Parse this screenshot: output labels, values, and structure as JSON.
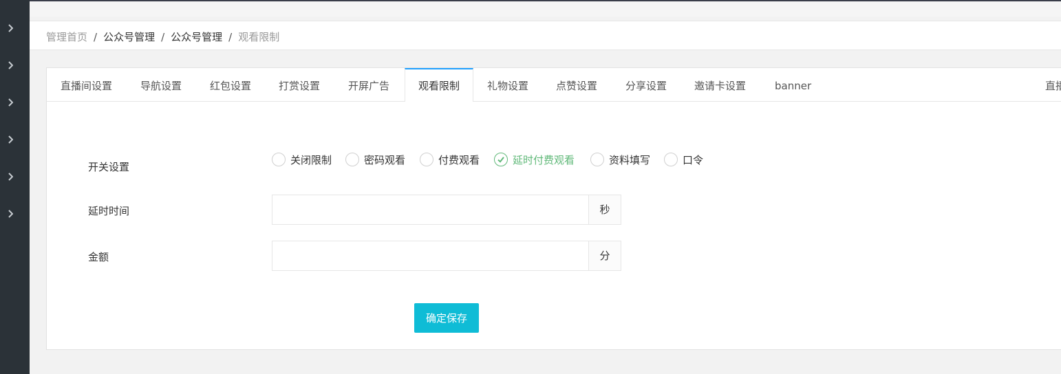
{
  "sidebar": {
    "arrow_count": 6
  },
  "breadcrumb": {
    "items": [
      "管理首页",
      "公众号管理",
      "公众号管理",
      "观看限制"
    ],
    "separator": "/"
  },
  "tabs": [
    {
      "label": "直播间设置"
    },
    {
      "label": "导航设置"
    },
    {
      "label": "红包设置"
    },
    {
      "label": "打赏设置"
    },
    {
      "label": "开屏广告"
    },
    {
      "label": "观看限制",
      "active": true
    },
    {
      "label": "礼物设置"
    },
    {
      "label": "点赞设置"
    },
    {
      "label": "分享设置"
    },
    {
      "label": "邀请卡设置"
    },
    {
      "label": "banner"
    },
    {
      "label": "直播"
    }
  ],
  "form": {
    "switch_label": "开关设置",
    "options": [
      {
        "label": "关闭限制",
        "checked": false
      },
      {
        "label": "密码观看",
        "checked": false
      },
      {
        "label": "付费观看",
        "checked": false
      },
      {
        "label": "延时付费观看",
        "checked": true
      },
      {
        "label": "资料填写",
        "checked": false
      },
      {
        "label": "口令",
        "checked": false
      }
    ],
    "delay_label": "延时时间",
    "delay_value": "",
    "delay_unit": "秒",
    "amount_label": "金额",
    "amount_value": "",
    "amount_unit": "分",
    "save_label": "确定保存"
  },
  "colors": {
    "sidebar_bg": "#2b3238",
    "active_tab_border": "#1e9fff",
    "checked_green": "#5fb878",
    "save_button": "#0fbcd6"
  }
}
